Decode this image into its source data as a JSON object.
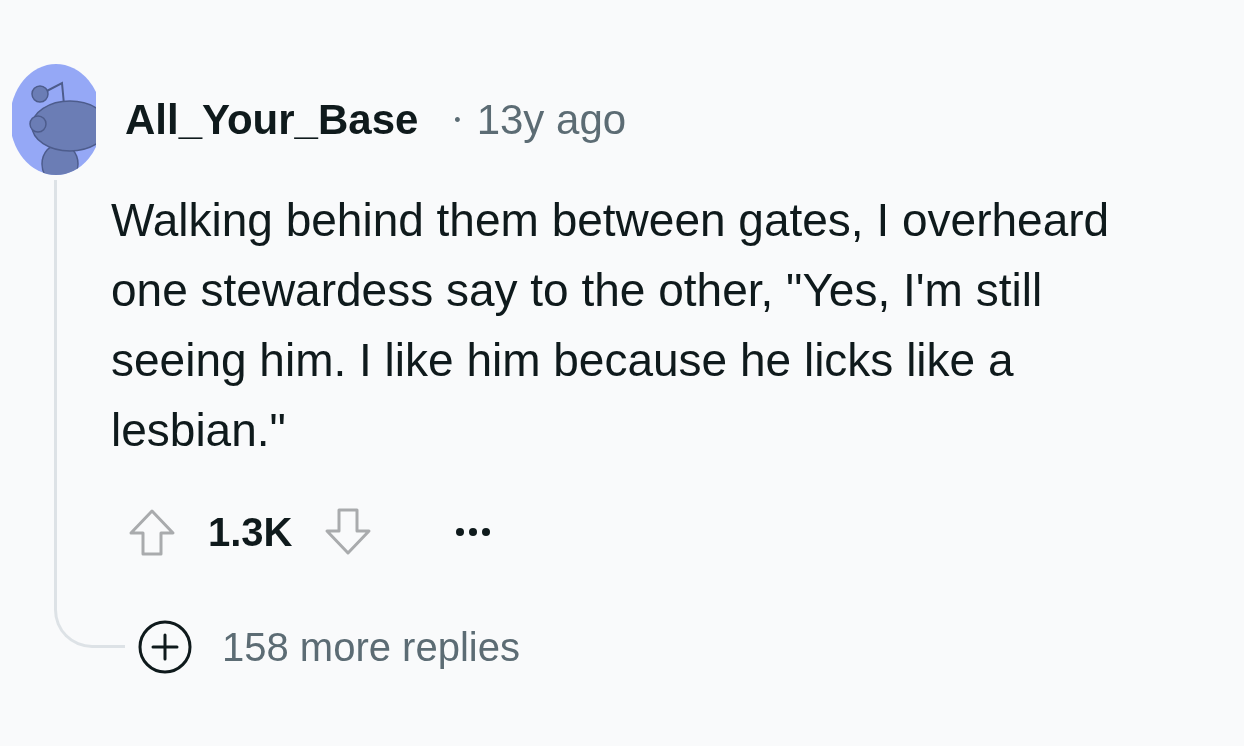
{
  "comment": {
    "author": "All_Your_Base",
    "separator": "•",
    "time": "13y ago",
    "body": "Walking behind them between gates, I overheard one stewardess say to the other, \"Yes, I'm still seeing him. I like him because he licks like a lesbian.\"",
    "score": "1.3K",
    "more_replies": "158 more replies"
  }
}
